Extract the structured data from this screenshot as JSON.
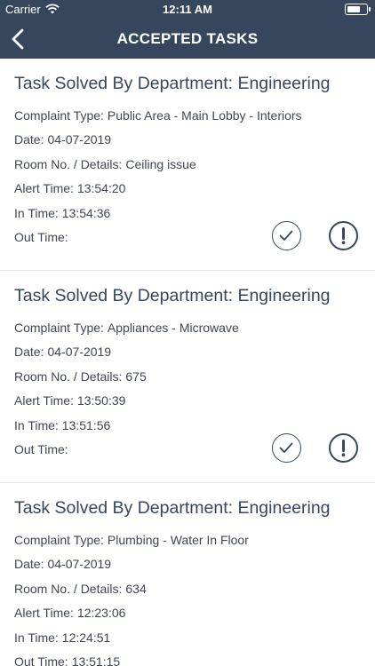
{
  "status_bar": {
    "carrier": "Carrier",
    "time": "12:11 AM"
  },
  "header": {
    "title": "ACCEPTED TASKS"
  },
  "labels": {
    "complaint_type": "Complaint Type:",
    "date": "Date:",
    "room": "Room No. / Details:",
    "alert_time": "Alert Time:",
    "in_time": "In Time:",
    "out_time": "Out Time:"
  },
  "tasks": [
    {
      "title": "Task Solved By Department: Engineering",
      "complaint_type": "Public Area - Main Lobby - Interiors",
      "date": "04-07-2019",
      "room": "Ceiling issue",
      "alert_time": "13:54:20",
      "in_time": "13:54:36",
      "out_time": ""
    },
    {
      "title": "Task Solved By Department: Engineering",
      "complaint_type": "Appliances - Microwave",
      "date": "04-07-2019",
      "room": "675",
      "alert_time": "13:50:39",
      "in_time": "13:51:56",
      "out_time": ""
    },
    {
      "title": "Task Solved By Department: Engineering",
      "complaint_type": "Plumbing - Water In Floor",
      "date": "04-07-2019",
      "room": "634",
      "alert_time": "12:23:06",
      "in_time": "12:24:51",
      "out_time": "13:51:15"
    }
  ],
  "colors": {
    "header_bg": "#36475d",
    "text": "#3f4553",
    "divider": "#e3e5e8"
  }
}
